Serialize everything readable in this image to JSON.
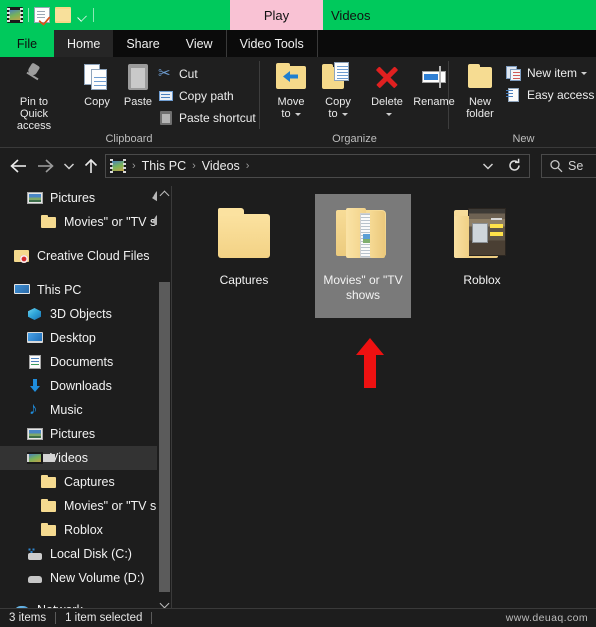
{
  "titlebar": {
    "quick_access_icons": [
      "film-videos-icon",
      "properties-icon",
      "new-folder-icon",
      "customize-qat-caret-icon"
    ],
    "play_tab_label": "Play",
    "window_title": "Videos",
    "accent_green": "#00c95c",
    "play_tab_pink": "#f9c2d4"
  },
  "menubar": {
    "tabs": [
      {
        "label": "File",
        "state": "file"
      },
      {
        "label": "Home",
        "state": "active"
      },
      {
        "label": "Share",
        "state": "normal"
      },
      {
        "label": "View",
        "state": "normal"
      },
      {
        "label": "Video Tools",
        "state": "contextual"
      }
    ]
  },
  "ribbon": {
    "groups": [
      {
        "label": "Clipboard"
      },
      {
        "label": "Organize"
      },
      {
        "label": "New"
      }
    ],
    "clipboard": {
      "pin_label": "Pin to Quick\naccess",
      "copy_label": "Copy",
      "paste_label": "Paste",
      "cut_label": "Cut",
      "copy_path_label": "Copy path",
      "paste_shortcut_label": "Paste shortcut"
    },
    "organize": {
      "move_to_label": "Move\nto",
      "copy_to_label": "Copy\nto",
      "delete_label": "Delete",
      "rename_label": "Rename"
    },
    "new_group": {
      "new_folder_label": "New\nfolder",
      "new_item_label": "New item",
      "easy_access_label": "Easy access"
    }
  },
  "addressbar": {
    "back_icon": "back-arrow-icon",
    "forward_icon": "forward-arrow-icon",
    "recent_icon": "recent-locations-caret-icon",
    "up_icon": "up-arrow-icon",
    "breadcrumbs": [
      "This PC",
      "Videos"
    ],
    "separator": "›",
    "dropdown_icon": "chevron-down-icon",
    "refresh_icon": "refresh-icon",
    "search_placeholder": "Se"
  },
  "sidebar": {
    "items": [
      {
        "label": "Pictures",
        "icon": "pictures-icon",
        "indent": 1,
        "pinned": true,
        "selected": false
      },
      {
        "label": "Movies\" or \"TV sh",
        "icon": "folder-icon",
        "indent": 2,
        "pinned": true,
        "selected": false
      },
      {
        "label": "Creative Cloud Files",
        "icon": "creative-cloud-icon",
        "indent": 0,
        "pinned": false,
        "selected": false
      },
      {
        "label": "This PC",
        "icon": "this-pc-icon",
        "indent": 0,
        "pinned": false,
        "selected": false
      },
      {
        "label": "3D Objects",
        "icon": "3d-objects-icon",
        "indent": 1,
        "pinned": false,
        "selected": false
      },
      {
        "label": "Desktop",
        "icon": "desktop-icon",
        "indent": 1,
        "pinned": false,
        "selected": false
      },
      {
        "label": "Documents",
        "icon": "documents-icon",
        "indent": 1,
        "pinned": false,
        "selected": false
      },
      {
        "label": "Downloads",
        "icon": "downloads-icon",
        "indent": 1,
        "pinned": false,
        "selected": false
      },
      {
        "label": "Music",
        "icon": "music-icon",
        "indent": 1,
        "pinned": false,
        "selected": false
      },
      {
        "label": "Pictures",
        "icon": "pictures-icon",
        "indent": 1,
        "pinned": false,
        "selected": false
      },
      {
        "label": "Videos",
        "icon": "videos-icon",
        "indent": 1,
        "pinned": false,
        "selected": true
      },
      {
        "label": "Captures",
        "icon": "folder-icon",
        "indent": 2,
        "pinned": false,
        "selected": false
      },
      {
        "label": "Movies\" or \"TV sho",
        "icon": "folder-icon",
        "indent": 2,
        "pinned": false,
        "selected": false
      },
      {
        "label": "Roblox",
        "icon": "folder-icon",
        "indent": 2,
        "pinned": false,
        "selected": false
      },
      {
        "label": "Local Disk (C:)",
        "icon": "local-disk-icon",
        "indent": 1,
        "pinned": false,
        "selected": false
      },
      {
        "label": "New Volume (D:)",
        "icon": "drive-icon",
        "indent": 1,
        "pinned": false,
        "selected": false
      },
      {
        "label": "Network",
        "icon": "network-icon",
        "indent": 0,
        "pinned": false,
        "selected": false
      }
    ]
  },
  "content": {
    "tiles": [
      {
        "name": "Captures",
        "icon": "plain-folder-icon",
        "selected": false
      },
      {
        "name": "Movies\" or \"TV shows",
        "icon": "open-folder-with-documents-icon",
        "selected": true
      },
      {
        "name": "Roblox",
        "icon": "folder-with-screenshot-thumbnail-icon",
        "selected": false
      }
    ],
    "annotation": {
      "type": "red-arrow-up",
      "color": "#ee1111",
      "points_to": "Movies\" or \"TV shows"
    }
  },
  "statusbar": {
    "item_count": "3 items",
    "selection": "1 item selected",
    "watermark": "www.deuaq.com"
  }
}
